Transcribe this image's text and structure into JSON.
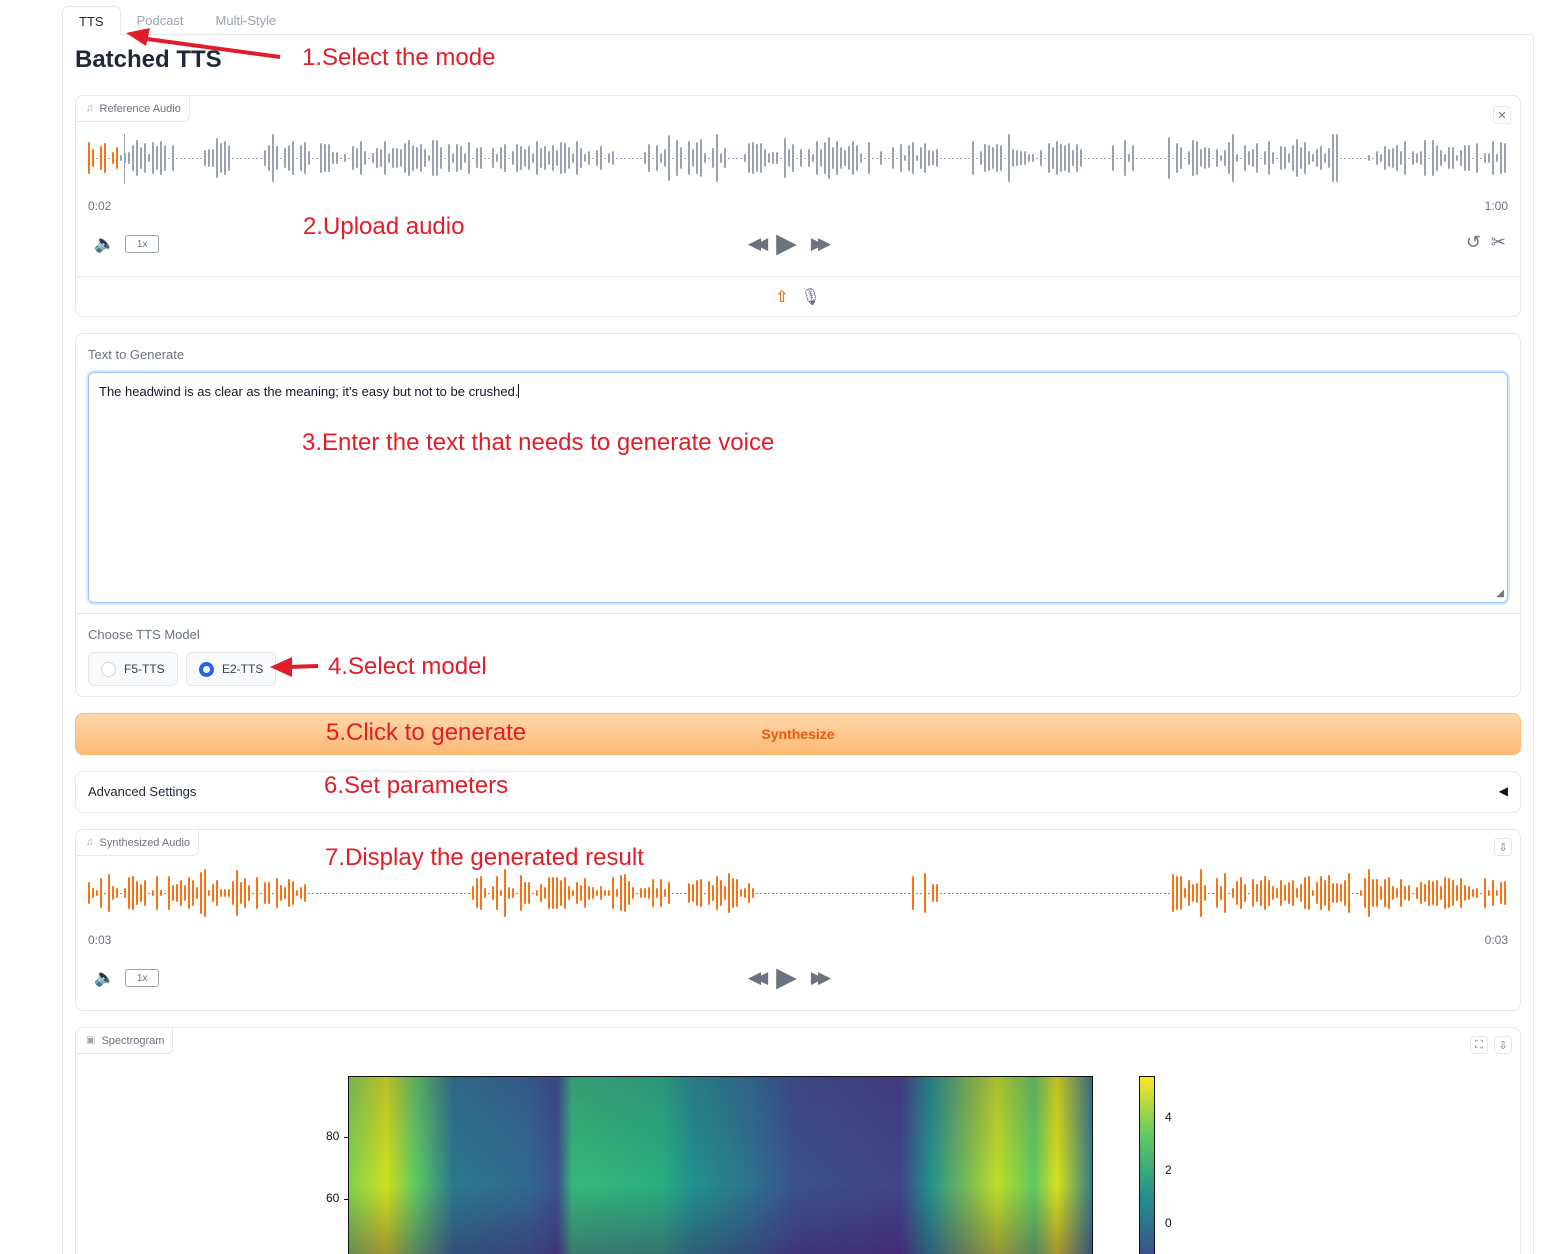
{
  "tabs": [
    {
      "label": "TTS",
      "active": true
    },
    {
      "label": "Podcast",
      "active": false
    },
    {
      "label": "Multi-Style",
      "active": false
    }
  ],
  "page_title": "Batched TTS",
  "reference_audio": {
    "label": "Reference Audio",
    "current_time": "0:02",
    "duration": "1:00",
    "rate": "1x",
    "progress": 0.02,
    "played_color": "#f97316",
    "wave_color": "#9ca3af"
  },
  "text_input": {
    "label": "Text to Generate",
    "value": "The headwind is as clear as the meaning; it's easy but not to be crushed."
  },
  "model": {
    "label": "Choose TTS Model",
    "options": [
      "F5-TTS",
      "E2-TTS"
    ],
    "selected": "E2-TTS"
  },
  "synthesize_label": "Synthesize",
  "advanced_label": "Advanced Settings",
  "advanced_arrow": "◀",
  "synth_audio": {
    "label": "Synthesized Audio",
    "current_time": "0:03",
    "duration": "0:03",
    "rate": "1x",
    "wave_color": "#f97316"
  },
  "spectrogram": {
    "label": "Spectrogram",
    "y_ticks": [
      "80",
      "60"
    ],
    "colorbar_ticks": [
      "4",
      "2",
      "0"
    ]
  },
  "annotations": [
    "1.Select the mode",
    "2.Upload audio",
    "3.Enter the text that needs to generate voice",
    "4.Select model",
    "5.Click to generate",
    "6.Set parameters",
    "7.Display the generated result"
  ],
  "icons": {
    "audio_label": "♫",
    "close": "✕",
    "speaker": "🔈",
    "rewind": "◀◀",
    "play": "▶",
    "forward": "▶▶",
    "undo": "↺",
    "scissors": "✂",
    "upload": "⇧",
    "mic": "🎙",
    "download": "⇩",
    "fullscreen": "⛶",
    "image": "▣",
    "resize": "◢"
  },
  "colors": {
    "accent": "#f97316",
    "annotation": "#e11d2a",
    "selected_radio": "#2563eb"
  }
}
